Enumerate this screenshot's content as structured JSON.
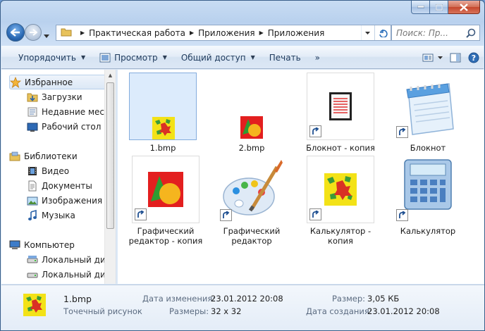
{
  "address": {
    "crumbs": [
      "Практическая работа",
      "Приложения",
      "Приложения"
    ],
    "search_placeholder": "Поиск: Пр..."
  },
  "toolbar": {
    "organize": "Упорядочить",
    "view": "Просмотр",
    "share": "Общий доступ",
    "print": "Печать",
    "more": "»"
  },
  "nav": {
    "favorites": "Избранное",
    "downloads": "Загрузки",
    "recent": "Недавние места",
    "desktop": "Рабочий стол",
    "libraries": "Библиотеки",
    "video": "Видео",
    "documents": "Документы",
    "images": "Изображения",
    "music": "Музыка",
    "computer": "Компьютер",
    "local_disk_1": "Локальный диск",
    "local_disk_2": "Локальный диск"
  },
  "files": [
    {
      "name": "1.bmp"
    },
    {
      "name": "2.bmp"
    },
    {
      "name": "Блокнот - копия"
    },
    {
      "name": "Блокнот"
    },
    {
      "name": "Графический редактор - копия"
    },
    {
      "name": "Графический редактор"
    },
    {
      "name": "Калькулятор - копия"
    },
    {
      "name": "Калькулятор"
    }
  ],
  "details": {
    "name": "1.bmp",
    "type": "Точечный рисунок",
    "modified_label": "Дата изменения:",
    "modified_value": "23.01.2012 20:08",
    "dims_label": "Размеры:",
    "dims_value": "32 x 32",
    "size_label": "Размер:",
    "size_value": "3,05 КБ",
    "created_label": "Дата создания:",
    "created_value": "23.01.2012 20:08"
  },
  "colors": {
    "selection": "#dcebfc",
    "accent": "#1e3a5c"
  }
}
